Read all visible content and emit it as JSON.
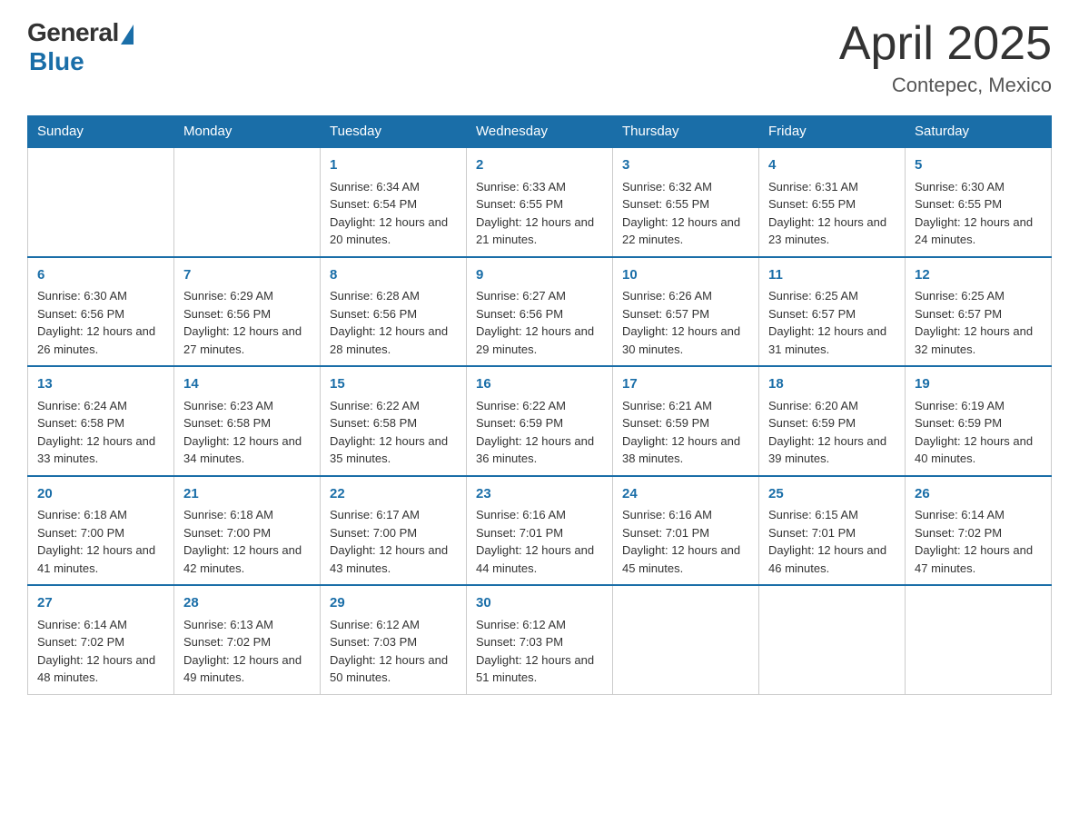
{
  "header": {
    "logo": {
      "general": "General",
      "blue": "Blue",
      "subtitle": "Blue"
    },
    "title": "April 2025",
    "location": "Contepec, Mexico"
  },
  "days_of_week": [
    "Sunday",
    "Monday",
    "Tuesday",
    "Wednesday",
    "Thursday",
    "Friday",
    "Saturday"
  ],
  "weeks": [
    [
      {
        "day": "",
        "sunrise": "",
        "sunset": "",
        "daylight": ""
      },
      {
        "day": "",
        "sunrise": "",
        "sunset": "",
        "daylight": ""
      },
      {
        "day": "1",
        "sunrise": "Sunrise: 6:34 AM",
        "sunset": "Sunset: 6:54 PM",
        "daylight": "Daylight: 12 hours and 20 minutes."
      },
      {
        "day": "2",
        "sunrise": "Sunrise: 6:33 AM",
        "sunset": "Sunset: 6:55 PM",
        "daylight": "Daylight: 12 hours and 21 minutes."
      },
      {
        "day": "3",
        "sunrise": "Sunrise: 6:32 AM",
        "sunset": "Sunset: 6:55 PM",
        "daylight": "Daylight: 12 hours and 22 minutes."
      },
      {
        "day": "4",
        "sunrise": "Sunrise: 6:31 AM",
        "sunset": "Sunset: 6:55 PM",
        "daylight": "Daylight: 12 hours and 23 minutes."
      },
      {
        "day": "5",
        "sunrise": "Sunrise: 6:30 AM",
        "sunset": "Sunset: 6:55 PM",
        "daylight": "Daylight: 12 hours and 24 minutes."
      }
    ],
    [
      {
        "day": "6",
        "sunrise": "Sunrise: 6:30 AM",
        "sunset": "Sunset: 6:56 PM",
        "daylight": "Daylight: 12 hours and 26 minutes."
      },
      {
        "day": "7",
        "sunrise": "Sunrise: 6:29 AM",
        "sunset": "Sunset: 6:56 PM",
        "daylight": "Daylight: 12 hours and 27 minutes."
      },
      {
        "day": "8",
        "sunrise": "Sunrise: 6:28 AM",
        "sunset": "Sunset: 6:56 PM",
        "daylight": "Daylight: 12 hours and 28 minutes."
      },
      {
        "day": "9",
        "sunrise": "Sunrise: 6:27 AM",
        "sunset": "Sunset: 6:56 PM",
        "daylight": "Daylight: 12 hours and 29 minutes."
      },
      {
        "day": "10",
        "sunrise": "Sunrise: 6:26 AM",
        "sunset": "Sunset: 6:57 PM",
        "daylight": "Daylight: 12 hours and 30 minutes."
      },
      {
        "day": "11",
        "sunrise": "Sunrise: 6:25 AM",
        "sunset": "Sunset: 6:57 PM",
        "daylight": "Daylight: 12 hours and 31 minutes."
      },
      {
        "day": "12",
        "sunrise": "Sunrise: 6:25 AM",
        "sunset": "Sunset: 6:57 PM",
        "daylight": "Daylight: 12 hours and 32 minutes."
      }
    ],
    [
      {
        "day": "13",
        "sunrise": "Sunrise: 6:24 AM",
        "sunset": "Sunset: 6:58 PM",
        "daylight": "Daylight: 12 hours and 33 minutes."
      },
      {
        "day": "14",
        "sunrise": "Sunrise: 6:23 AM",
        "sunset": "Sunset: 6:58 PM",
        "daylight": "Daylight: 12 hours and 34 minutes."
      },
      {
        "day": "15",
        "sunrise": "Sunrise: 6:22 AM",
        "sunset": "Sunset: 6:58 PM",
        "daylight": "Daylight: 12 hours and 35 minutes."
      },
      {
        "day": "16",
        "sunrise": "Sunrise: 6:22 AM",
        "sunset": "Sunset: 6:59 PM",
        "daylight": "Daylight: 12 hours and 36 minutes."
      },
      {
        "day": "17",
        "sunrise": "Sunrise: 6:21 AM",
        "sunset": "Sunset: 6:59 PM",
        "daylight": "Daylight: 12 hours and 38 minutes."
      },
      {
        "day": "18",
        "sunrise": "Sunrise: 6:20 AM",
        "sunset": "Sunset: 6:59 PM",
        "daylight": "Daylight: 12 hours and 39 minutes."
      },
      {
        "day": "19",
        "sunrise": "Sunrise: 6:19 AM",
        "sunset": "Sunset: 6:59 PM",
        "daylight": "Daylight: 12 hours and 40 minutes."
      }
    ],
    [
      {
        "day": "20",
        "sunrise": "Sunrise: 6:18 AM",
        "sunset": "Sunset: 7:00 PM",
        "daylight": "Daylight: 12 hours and 41 minutes."
      },
      {
        "day": "21",
        "sunrise": "Sunrise: 6:18 AM",
        "sunset": "Sunset: 7:00 PM",
        "daylight": "Daylight: 12 hours and 42 minutes."
      },
      {
        "day": "22",
        "sunrise": "Sunrise: 6:17 AM",
        "sunset": "Sunset: 7:00 PM",
        "daylight": "Daylight: 12 hours and 43 minutes."
      },
      {
        "day": "23",
        "sunrise": "Sunrise: 6:16 AM",
        "sunset": "Sunset: 7:01 PM",
        "daylight": "Daylight: 12 hours and 44 minutes."
      },
      {
        "day": "24",
        "sunrise": "Sunrise: 6:16 AM",
        "sunset": "Sunset: 7:01 PM",
        "daylight": "Daylight: 12 hours and 45 minutes."
      },
      {
        "day": "25",
        "sunrise": "Sunrise: 6:15 AM",
        "sunset": "Sunset: 7:01 PM",
        "daylight": "Daylight: 12 hours and 46 minutes."
      },
      {
        "day": "26",
        "sunrise": "Sunrise: 6:14 AM",
        "sunset": "Sunset: 7:02 PM",
        "daylight": "Daylight: 12 hours and 47 minutes."
      }
    ],
    [
      {
        "day": "27",
        "sunrise": "Sunrise: 6:14 AM",
        "sunset": "Sunset: 7:02 PM",
        "daylight": "Daylight: 12 hours and 48 minutes."
      },
      {
        "day": "28",
        "sunrise": "Sunrise: 6:13 AM",
        "sunset": "Sunset: 7:02 PM",
        "daylight": "Daylight: 12 hours and 49 minutes."
      },
      {
        "day": "29",
        "sunrise": "Sunrise: 6:12 AM",
        "sunset": "Sunset: 7:03 PM",
        "daylight": "Daylight: 12 hours and 50 minutes."
      },
      {
        "day": "30",
        "sunrise": "Sunrise: 6:12 AM",
        "sunset": "Sunset: 7:03 PM",
        "daylight": "Daylight: 12 hours and 51 minutes."
      },
      {
        "day": "",
        "sunrise": "",
        "sunset": "",
        "daylight": ""
      },
      {
        "day": "",
        "sunrise": "",
        "sunset": "",
        "daylight": ""
      },
      {
        "day": "",
        "sunrise": "",
        "sunset": "",
        "daylight": ""
      }
    ]
  ]
}
